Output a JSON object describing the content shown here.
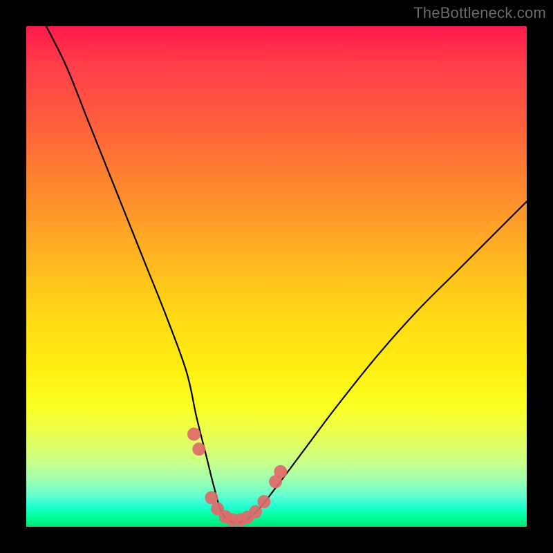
{
  "watermark": "TheBottleneck.com",
  "chart_data": {
    "type": "line",
    "title": "",
    "xlabel": "",
    "ylabel": "",
    "xlim": [
      0,
      100
    ],
    "ylim": [
      0,
      100
    ],
    "background_gradient_meaning": "top=red high, bottom=green low",
    "series": [
      {
        "name": "bottleneck-curve",
        "x": [
          4,
          8,
          12,
          16,
          20,
          24,
          28,
          32,
          34,
          36,
          37.5,
          39,
          41,
          43,
          46,
          50,
          56,
          62,
          70,
          78,
          86,
          94,
          100
        ],
        "values": [
          100,
          92,
          82,
          72,
          62,
          52,
          42,
          31,
          22,
          14,
          8,
          3,
          1,
          1,
          3,
          8,
          16,
          24,
          34,
          43,
          51,
          59,
          65
        ]
      }
    ],
    "markers": {
      "name": "highlighted-dots",
      "color": "#e06a6a",
      "points": [
        {
          "x": 33.5,
          "y": 18.5
        },
        {
          "x": 34.5,
          "y": 15.5
        },
        {
          "x": 37.0,
          "y": 5.8
        },
        {
          "x": 38.2,
          "y": 3.6
        },
        {
          "x": 39.8,
          "y": 2.0
        },
        {
          "x": 41.2,
          "y": 1.4
        },
        {
          "x": 42.8,
          "y": 1.4
        },
        {
          "x": 44.2,
          "y": 1.9
        },
        {
          "x": 45.8,
          "y": 3.0
        },
        {
          "x": 47.5,
          "y": 5.0
        },
        {
          "x": 49.8,
          "y": 9.0
        },
        {
          "x": 50.8,
          "y": 11.0
        }
      ]
    }
  }
}
